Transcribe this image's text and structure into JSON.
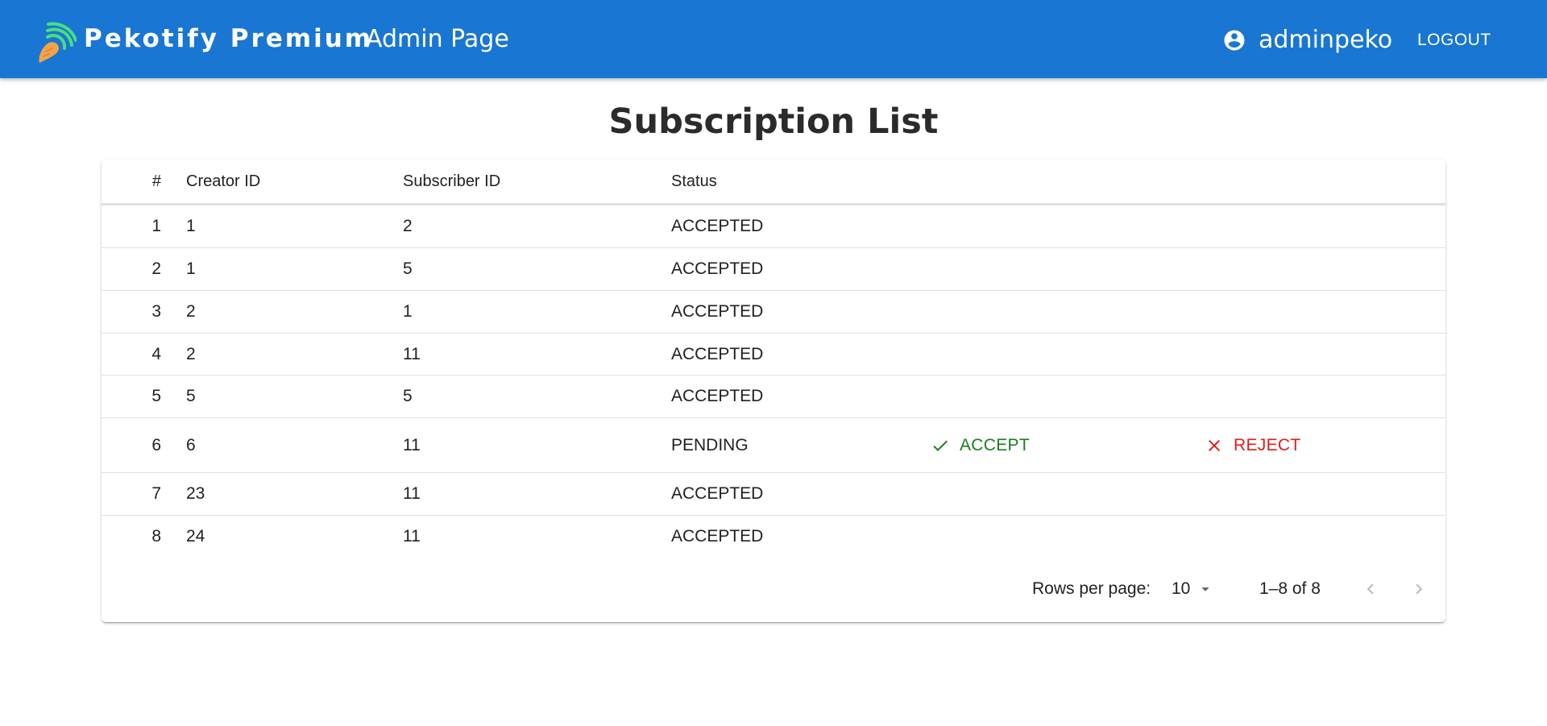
{
  "app": {
    "brand": "Pekotify Premium",
    "page_label": "Admin Page",
    "username": "adminpeko",
    "logout_label": "LOGOUT",
    "colors": {
      "appbar": "#1976d2",
      "accept": "#1b7d1b",
      "reject": "#e31b1b",
      "logo_waves": "#4ade80",
      "logo_carrot": "#f5a34a"
    }
  },
  "main": {
    "title": "Subscription List",
    "columns": [
      "#",
      "Creator ID",
      "Subscriber ID",
      "Status"
    ],
    "rows": [
      {
        "num": "1",
        "creator": "1",
        "subscriber": "2",
        "status": "ACCEPTED"
      },
      {
        "num": "2",
        "creator": "1",
        "subscriber": "5",
        "status": "ACCEPTED"
      },
      {
        "num": "3",
        "creator": "2",
        "subscriber": "1",
        "status": "ACCEPTED"
      },
      {
        "num": "4",
        "creator": "2",
        "subscriber": "11",
        "status": "ACCEPTED"
      },
      {
        "num": "5",
        "creator": "5",
        "subscriber": "5",
        "status": "ACCEPTED"
      },
      {
        "num": "6",
        "creator": "6",
        "subscriber": "11",
        "status": "PENDING",
        "accept_label": "ACCEPT",
        "reject_label": "REJECT"
      },
      {
        "num": "7",
        "creator": "23",
        "subscriber": "11",
        "status": "ACCEPTED"
      },
      {
        "num": "8",
        "creator": "24",
        "subscriber": "11",
        "status": "ACCEPTED"
      }
    ],
    "pagination": {
      "rows_per_page_label": "Rows per page:",
      "rows_per_page_value": "10",
      "range": "1–8 of 8"
    }
  },
  "icons": {
    "logo": "carrot-wifi-logo-icon",
    "user": "account-circle-icon",
    "accept": "check-icon",
    "reject": "close-icon",
    "dropdown": "caret-down-icon",
    "prev": "chevron-left-icon",
    "next": "chevron-right-icon"
  }
}
